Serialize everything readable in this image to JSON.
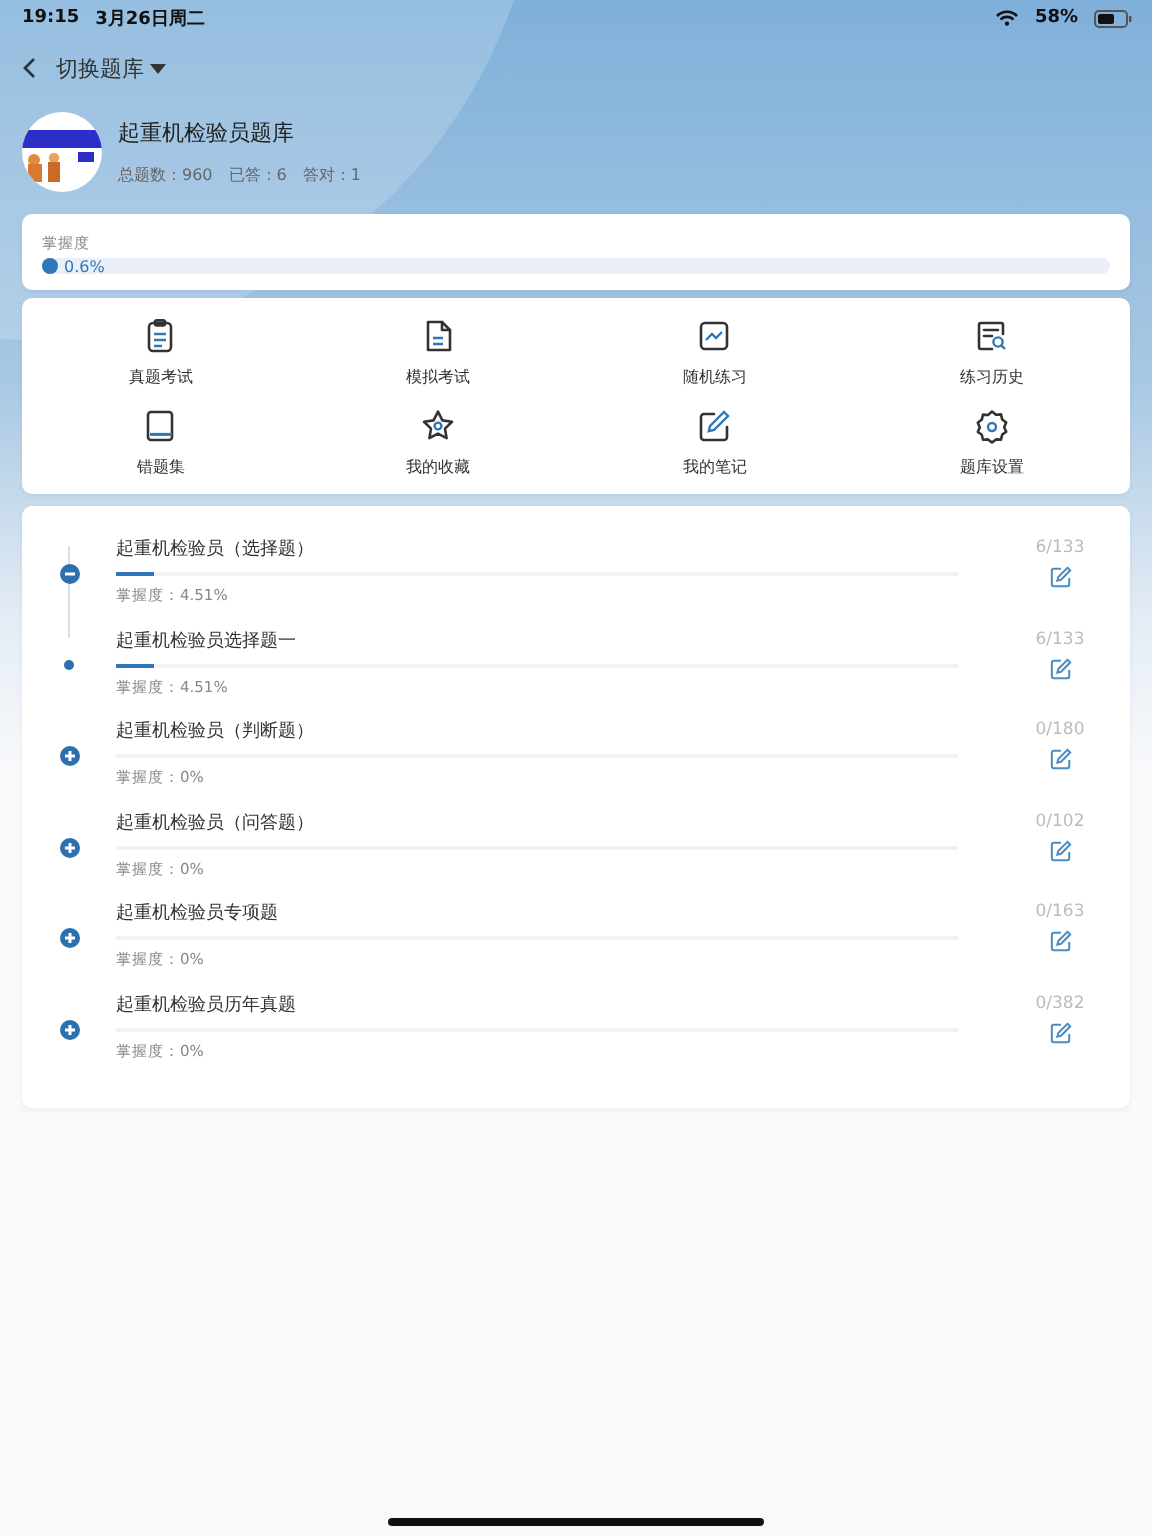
{
  "status_bar": {
    "time": "19:15",
    "date": "3月26日周二",
    "battery": "58%"
  },
  "nav": {
    "title": "切换题库"
  },
  "bank": {
    "name": "起重机检验员题库",
    "stats": [
      "总题数：960",
      "已答：6",
      "答对：1"
    ]
  },
  "mastery": {
    "label": "掌握度",
    "reading": "0.6%",
    "level": 0.006
  },
  "menu": [
    {
      "label": "真题考试"
    },
    {
      "label": "模拟考试"
    },
    {
      "label": "随机练习"
    },
    {
      "label": "练习历史"
    },
    {
      "label": "错题集"
    },
    {
      "label": "我的收藏"
    },
    {
      "label": "我的笔记"
    },
    {
      "label": "题库设置"
    }
  ],
  "chapters": [
    {
      "title": "起重机检验员（选择题）",
      "mastery": "掌握度：4.51%",
      "level": 0.0451,
      "count": "6/133",
      "expanded": true,
      "children": [
        {
          "title": "起重机检验员选择题一",
          "mastery": "掌握度：4.51%",
          "level": 0.0451,
          "count": "6/133"
        }
      ]
    },
    {
      "title": "起重机检验员（判断题）",
      "mastery": "掌握度：0%",
      "level": 0,
      "count": "0/180",
      "expanded": false
    },
    {
      "title": "起重机检验员（问答题）",
      "mastery": "掌握度：0%",
      "level": 0,
      "count": "0/102",
      "expanded": false
    },
    {
      "title": "起重机检验员专项题",
      "mastery": "掌握度：0%",
      "level": 0,
      "count": "0/163",
      "expanded": false
    },
    {
      "title": "起重机检验员历年真题",
      "mastery": "掌握度：0%",
      "level": 0,
      "count": "0/382",
      "expanded": false
    }
  ]
}
